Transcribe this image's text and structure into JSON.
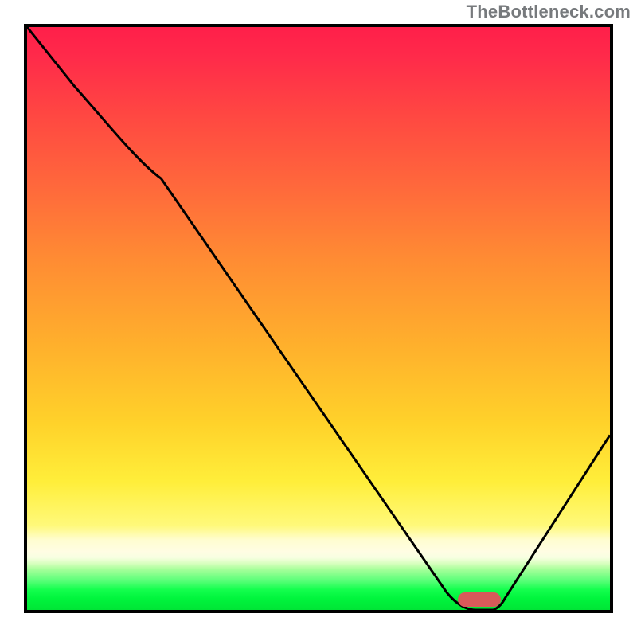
{
  "watermark": "TheBottleneck.com",
  "chart_data": {
    "type": "line",
    "title": "",
    "xlabel": "",
    "ylabel": "",
    "xlim": [
      0,
      100
    ],
    "ylim": [
      0,
      100
    ],
    "grid": false,
    "series": [
      {
        "name": "bottleneck-curve",
        "x": [
          0,
          8,
          18,
          23,
          72,
          77,
          80,
          82,
          100
        ],
        "y": [
          100,
          90,
          78,
          74,
          3,
          0,
          0,
          2,
          30
        ]
      }
    ],
    "trough_marker": {
      "x_center": 77,
      "x_width": 8,
      "y": 0,
      "color": "#d75a5a"
    },
    "background_gradient": {
      "orientation": "vertical",
      "stops": [
        {
          "pct": 0,
          "color": "#ff1f4a"
        },
        {
          "pct": 15,
          "color": "#ff4742"
        },
        {
          "pct": 40,
          "color": "#ff8c33"
        },
        {
          "pct": 68,
          "color": "#ffd22a"
        },
        {
          "pct": 88,
          "color": "#fffdd0"
        },
        {
          "pct": 93,
          "color": "#a8ff9b"
        },
        {
          "pct": 100,
          "color": "#00e536"
        }
      ]
    }
  }
}
